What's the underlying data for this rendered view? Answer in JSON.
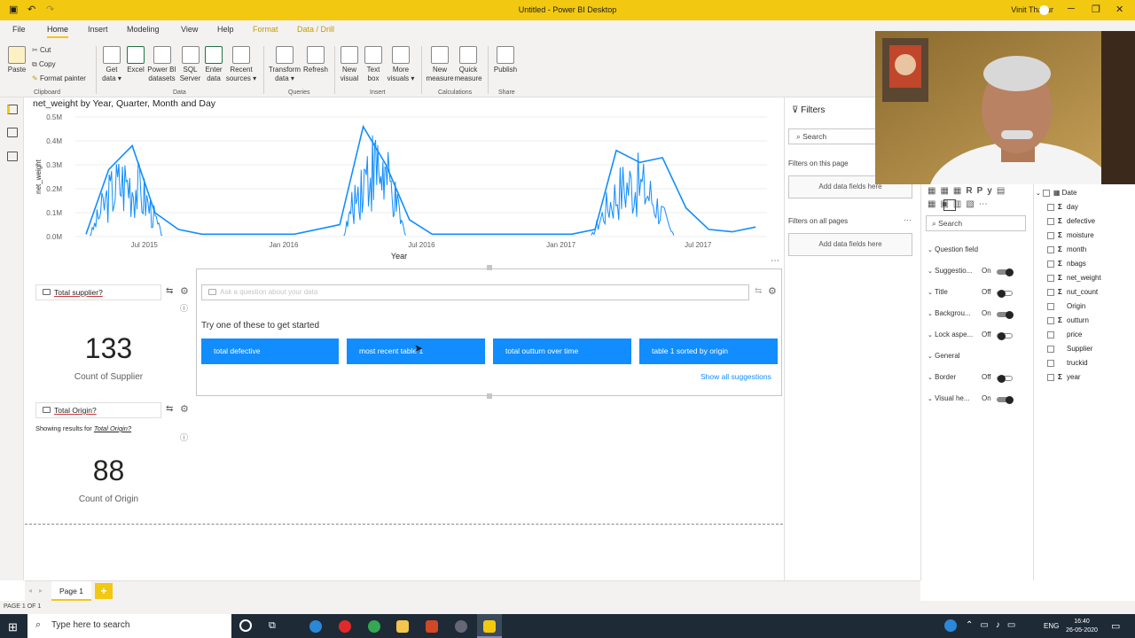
{
  "titlebar": {
    "title": "Untitled - Power BI Desktop",
    "user": "Vinit Thakur"
  },
  "menu": {
    "tabs": [
      "File",
      "Home",
      "Insert",
      "Modeling",
      "View",
      "Help",
      "Format",
      "Data / Drill"
    ],
    "active": "Home"
  },
  "ribbon": {
    "clipboard": {
      "paste": "Paste",
      "cut": "Cut",
      "copy": "Copy",
      "format_painter": "Format painter",
      "group": "Clipboard"
    },
    "data": {
      "get_data": "Get data",
      "excel": "Excel",
      "pbi_datasets": "Power BI datasets",
      "sql_server": "SQL Server",
      "enter_data": "Enter data",
      "recent_sources": "Recent sources",
      "group": "Data"
    },
    "queries": {
      "transform": "Transform data",
      "refresh": "Refresh",
      "group": "Queries"
    },
    "insert": {
      "new_visual": "New visual",
      "text_box": "Text box",
      "more_visuals": "More visuals",
      "group": "Insert"
    },
    "calculations": {
      "new_measure": "New measure",
      "quick_measure": "Quick measure",
      "group": "Calculations"
    },
    "share": {
      "publish": "Publish",
      "group": "Share"
    }
  },
  "chart_data": {
    "type": "line",
    "title": "net_weight by Year, Quarter, Month and Day",
    "xlabel": "Year",
    "ylabel": "net_weight",
    "y_ticks": [
      "0.0M",
      "0.1M",
      "0.2M",
      "0.3M",
      "0.4M",
      "0.5M"
    ],
    "x_ticks": [
      "Jul 2015",
      "Jan 2016",
      "Jul 2016",
      "Jan 2017",
      "Jul 2017"
    ],
    "ylim": [
      0,
      0.5
    ],
    "series": [
      {
        "color": "#118dff",
        "x": [
          "2015-04",
          "2015-05",
          "2015-06",
          "2015-07",
          "2015-08",
          "2015-09",
          "2015-10",
          "2016-01",
          "2016-03",
          "2016-04",
          "2016-05",
          "2016-06",
          "2016-07",
          "2016-10",
          "2017-01",
          "2017-02",
          "2017-03",
          "2017-04",
          "2017-05",
          "2017-06",
          "2017-07",
          "2017-08",
          "2017-09"
        ],
        "values": [
          0.01,
          0.28,
          0.38,
          0.1,
          0.03,
          0.01,
          0.01,
          0.01,
          0.05,
          0.46,
          0.3,
          0.07,
          0.01,
          0.01,
          0.01,
          0.03,
          0.36,
          0.31,
          0.33,
          0.12,
          0.03,
          0.02,
          0.04
        ]
      }
    ]
  },
  "qa_visual": {
    "placeholder": "Ask a question about your data",
    "intro": "Try one of these to get started",
    "suggestions": [
      "total defective",
      "most recent table 1",
      "total outturn over time",
      "table 1 sorted by origin"
    ],
    "show_all": "Show all suggestions"
  },
  "card1": {
    "question": "Total supplier?",
    "value": "133",
    "label": "Count of Supplier"
  },
  "card2": {
    "question": "Total Origin?",
    "showing": "Showing results for",
    "showing_link": "Total Origin?",
    "value": "88",
    "label": "Count of Origin"
  },
  "filters": {
    "title": "Filters",
    "search": "Search",
    "on_page": "Filters on this page",
    "add1": "Add data fields here",
    "all_pages": "Filters on all pages",
    "add2": "Add data fields here"
  },
  "format": {
    "search": "Search",
    "sections": [
      {
        "label": "Question field",
        "state": ""
      },
      {
        "label": "Suggestio...",
        "state": "On"
      },
      {
        "label": "Title",
        "state": "Off"
      },
      {
        "label": "Backgrou...",
        "state": "On"
      },
      {
        "label": "Lock aspe...",
        "state": "Off"
      },
      {
        "label": "General",
        "state": ""
      },
      {
        "label": "Border",
        "state": "Off"
      },
      {
        "label": "Visual he...",
        "state": "On"
      }
    ]
  },
  "fields": {
    "table": "Date",
    "items": [
      {
        "name": "day",
        "sigma": true
      },
      {
        "name": "defective",
        "sigma": true
      },
      {
        "name": "moisture",
        "sigma": true
      },
      {
        "name": "month",
        "sigma": true
      },
      {
        "name": "nbags",
        "sigma": true
      },
      {
        "name": "net_weight",
        "sigma": true
      },
      {
        "name": "nut_count",
        "sigma": true
      },
      {
        "name": "Origin",
        "sigma": false
      },
      {
        "name": "outturn",
        "sigma": true
      },
      {
        "name": "price",
        "sigma": false
      },
      {
        "name": "Supplier",
        "sigma": false
      },
      {
        "name": "truckid",
        "sigma": false
      },
      {
        "name": "year",
        "sigma": true
      }
    ]
  },
  "pages": {
    "tab": "Page 1",
    "add": "+"
  },
  "status": {
    "page": "PAGE 1 OF 1"
  },
  "taskbar": {
    "search": "Type here to search",
    "lang": "ENG",
    "time": "16:40",
    "date": "26-05-2020"
  }
}
